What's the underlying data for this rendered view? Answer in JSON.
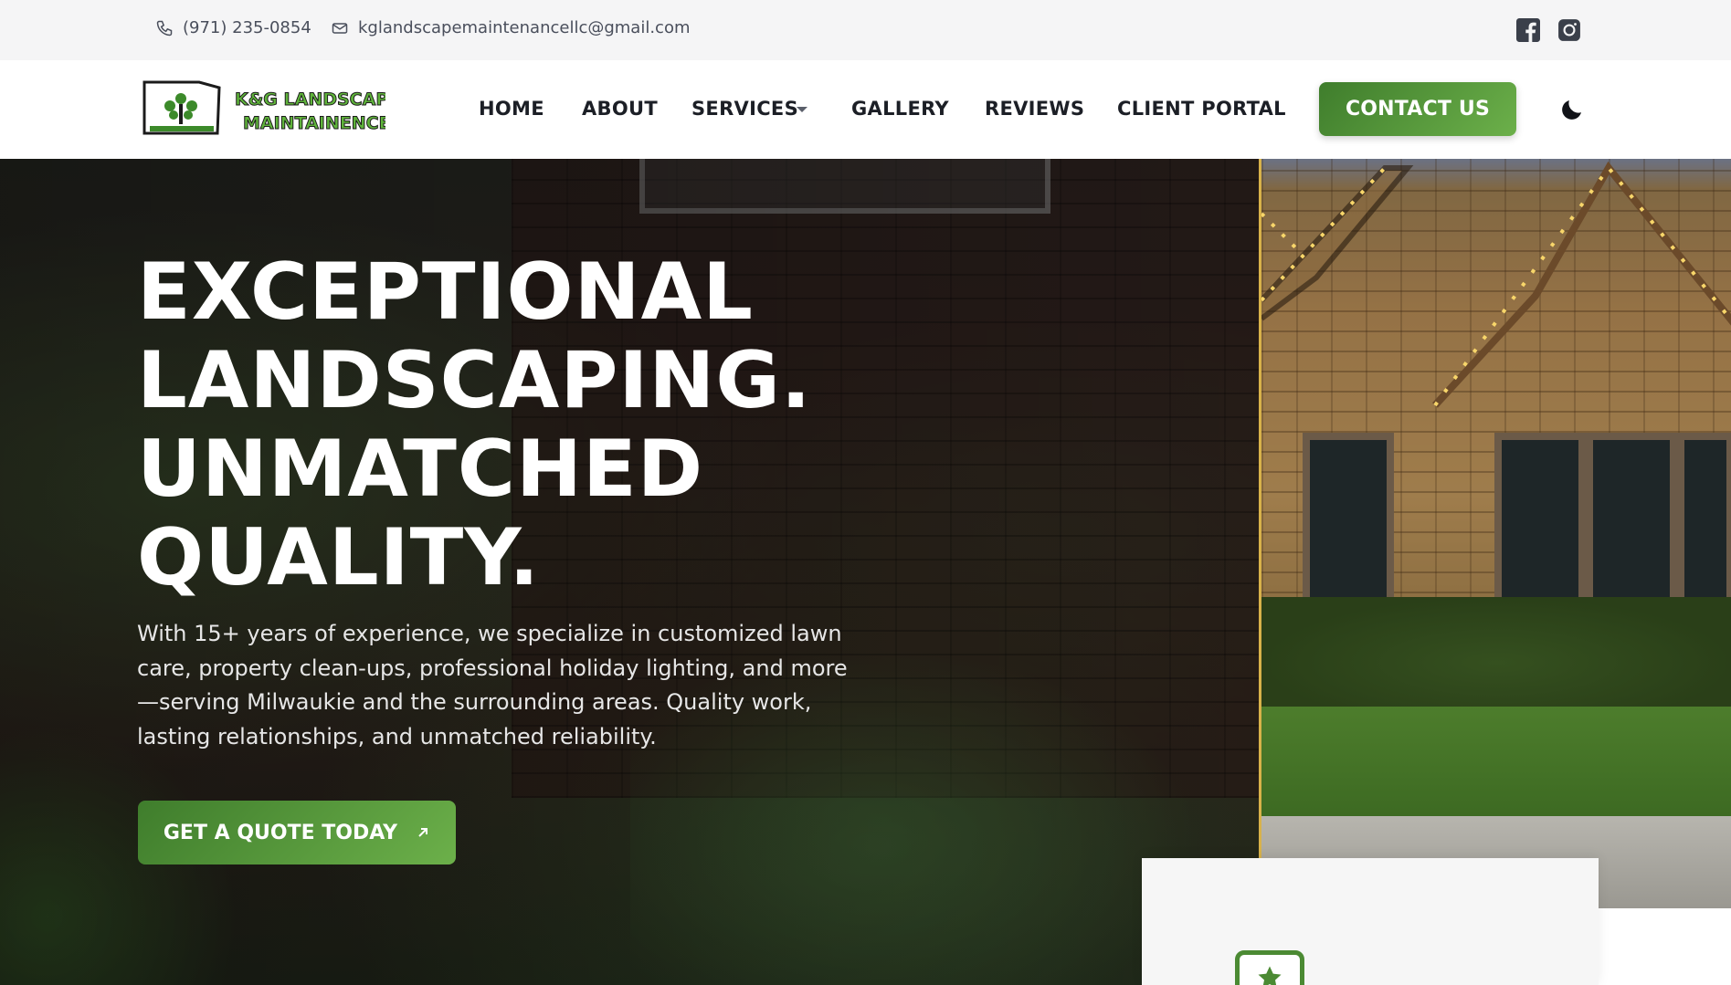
{
  "topbar": {
    "phone": "(971) 235-0854",
    "email": "kglandscapemaintenancellc@gmail.com",
    "social": [
      "facebook-icon",
      "instagram-icon"
    ]
  },
  "nav": {
    "logo_line1": "K&G LANDSCAPE",
    "logo_line2": "MAINTAINENCE",
    "links": [
      "HOME",
      "ABOUT",
      "SERVICES",
      "GALLERY",
      "REVIEWS",
      "CLIENT PORTAL"
    ],
    "contact_label": "CONTACT US",
    "theme_toggle_icon": "moon-icon"
  },
  "hero": {
    "title_lines": [
      "EXCEPTIONAL",
      "LANDSCAPING.",
      "UNMATCHED",
      "QUALITY."
    ],
    "description": "With 15+ years of experience, we specialize in customized lawn care, property clean-ups, professional holiday lighting, and more—serving Milwaukie and the surrounding areas. Quality work, lasting relationships, and unmatched reliability.",
    "cta_label": "GET A QUOTE TODAY",
    "cta_icon": "arrow-up-right-icon"
  },
  "card": {
    "badge_icon": "star-icon"
  },
  "colors": {
    "accent_green_dark": "#3f7d2c",
    "accent_green_light": "#6cb04a",
    "topbar_bg": "#f5f5f6",
    "nav_text": "#1c1f26"
  }
}
